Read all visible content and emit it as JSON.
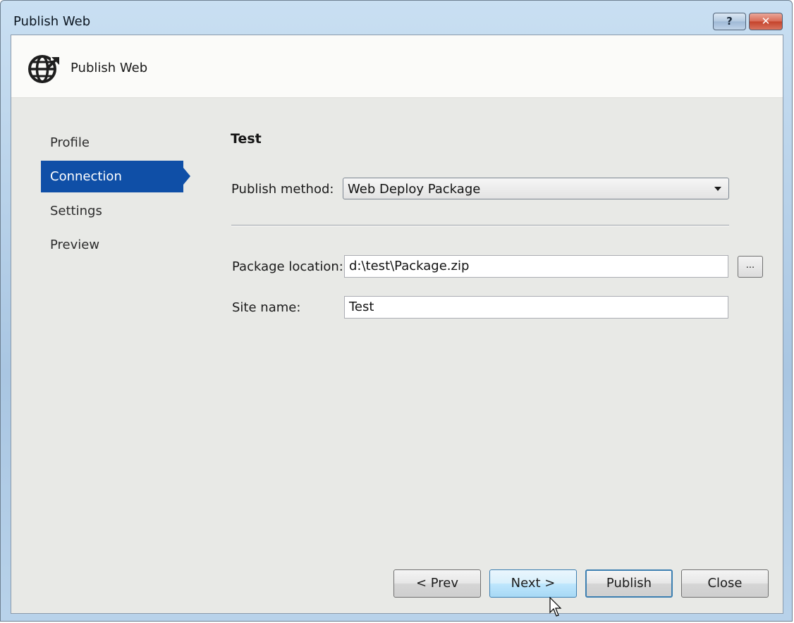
{
  "window": {
    "title": "Publish Web",
    "help_label": "?",
    "close_label": "✕"
  },
  "header": {
    "title": "Publish Web",
    "icon": "globe-upload-icon"
  },
  "nav": {
    "items": [
      {
        "label": "Profile",
        "active": false
      },
      {
        "label": "Connection",
        "active": true
      },
      {
        "label": "Settings",
        "active": false
      },
      {
        "label": "Preview",
        "active": false
      }
    ]
  },
  "main": {
    "section_title": "Test",
    "publish_method_label": "Publish method:",
    "publish_method_value": "Web Deploy Package",
    "package_location_label": "Package location:",
    "package_location_value": "d:\\test\\Package.zip",
    "browse_label": "...",
    "site_name_label": "Site name:",
    "site_name_value": "Test"
  },
  "footer": {
    "prev_label": "< Prev",
    "next_label": "Next >",
    "publish_label": "Publish",
    "close_label": "Close"
  },
  "colors": {
    "nav_active": "#0f4fa7",
    "client_bg": "#e8e9e6"
  }
}
